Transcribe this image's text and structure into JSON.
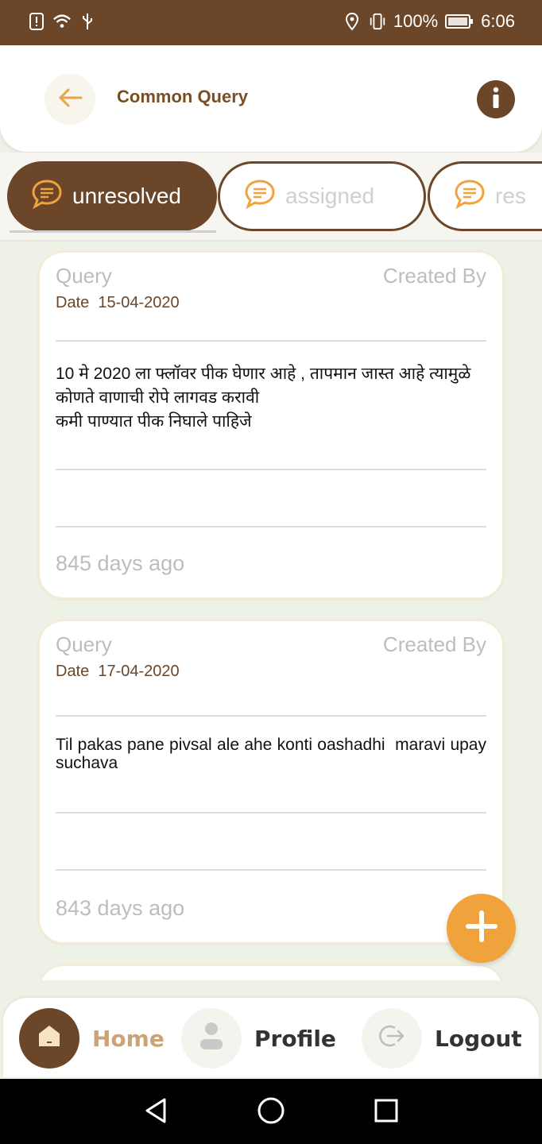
{
  "statusbar": {
    "battery": "100%",
    "time": "6:06",
    "icons": [
      "alert-icon",
      "wifi-icon",
      "usb-icon",
      "location-icon",
      "vibrate-icon",
      "battery-icon"
    ]
  },
  "header": {
    "title": "Common Query",
    "back_icon": "back-arrow-icon",
    "info_icon": "info-icon"
  },
  "tabs": [
    {
      "label": "unresolved",
      "active": true
    },
    {
      "label": "assigned",
      "active": false
    },
    {
      "label": "res",
      "active": false
    }
  ],
  "cards": [
    {
      "query_label": "Query",
      "created_label": "Created By",
      "date": "Date  15-04-2020",
      "text": "10 मे 2020 ला फ्लॉवर पीक घेणार आहे , तापमान जास्त आहे त्यामुळे कोणते वाणाची रोपे लागवड करावी\nकमी पाण्यात पीक निघाले पाहिजे",
      "ago": "845 days ago"
    },
    {
      "query_label": "Query",
      "created_label": "Created By",
      "date": "Date  17-04-2020",
      "text": "Til pakas pane pivsal ale ahe konti oashadhi  maravi upay suchava",
      "ago": "843 days ago"
    }
  ],
  "bottomnav": {
    "home": "Home",
    "profile": "Profile",
    "logout": "Logout"
  },
  "colors": {
    "brown": "#6b4628",
    "accent": "#f0a33c",
    "light_gray": "#bdbdbd"
  }
}
